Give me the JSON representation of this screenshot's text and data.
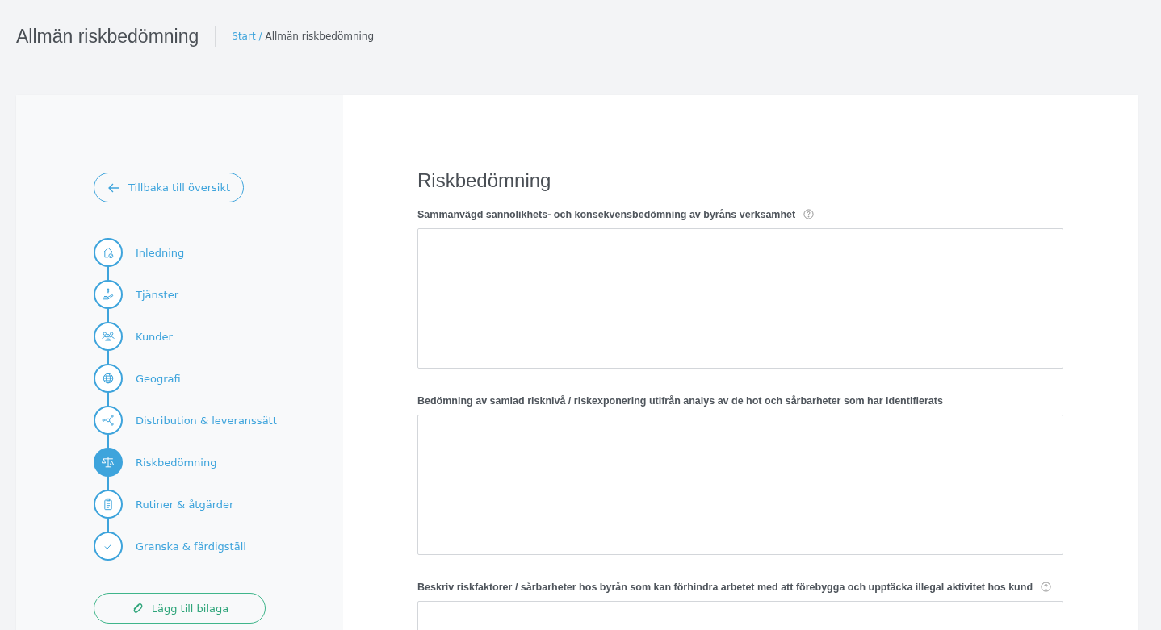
{
  "header": {
    "title": "Allmän riskbedömning",
    "breadcrumb": [
      {
        "label": "Start /",
        "kind": "link"
      },
      {
        "label": "Allmän riskbedömning",
        "kind": "current"
      }
    ]
  },
  "sidebar": {
    "back_button": "Tillbaka till översikt",
    "steps": [
      {
        "label": "Inledning",
        "selected": false
      },
      {
        "label": "Tjänster",
        "selected": false
      },
      {
        "label": "Kunder",
        "selected": false
      },
      {
        "label": "Geografi",
        "selected": false
      },
      {
        "label": "Distribution & leveranssätt",
        "selected": false
      },
      {
        "label": "Riskbedömning",
        "selected": true
      },
      {
        "label": "Rutiner & åtgärder",
        "selected": false
      },
      {
        "label": "Granska & färdigställ",
        "selected": false
      }
    ],
    "attach_button": "Lägg till bilaga"
  },
  "form": {
    "title": "Riskbedömning",
    "fields": [
      {
        "label": "Sammanvägd sannolikhets- och konsekvensbedömning av byråns verksamhet",
        "help": true
      },
      {
        "label": "Bedömning av samlad risknivå / riskexponering utifrån analys av de hot och sårbarheter som har identifierats",
        "help": false
      },
      {
        "label": "Beskriv riskfaktorer / sårbarheter hos byrån som kan förhindra arbetet med att förebygga och upptäcka illegal aktivitet hos kund",
        "help": true
      }
    ]
  }
}
